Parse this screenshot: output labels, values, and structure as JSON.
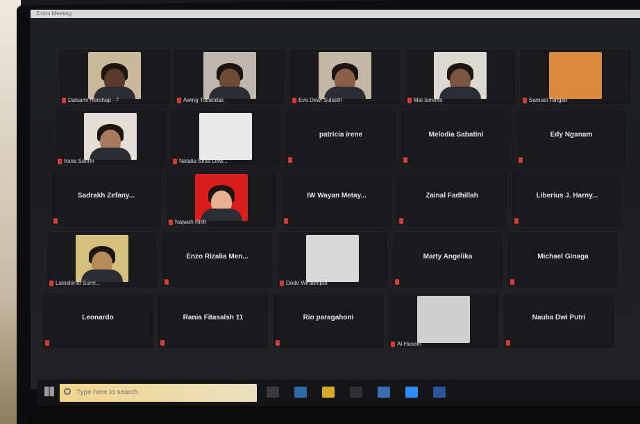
{
  "window": {
    "title": "Zoom Meeting"
  },
  "participants": [
    {
      "name": "Dalsami Harahap - 7",
      "mode": "video",
      "muted": true,
      "bg": "#c9b99a",
      "skin": "#5a3a2a"
    },
    {
      "name": "Awing Tobandas",
      "mode": "video",
      "muted": true,
      "bg": "#bdb7ad",
      "skin": "#6b4a36"
    },
    {
      "name": "Eva Dewi Sulastri",
      "mode": "video",
      "muted": true,
      "bg": "#c3b8a6",
      "skin": "#8a6048"
    },
    {
      "name": "Mai Ismeira",
      "mode": "video",
      "muted": true,
      "bg": "#dcd8d2",
      "skin": "#7a5640"
    },
    {
      "name": "Samuel Tarigan",
      "mode": "image",
      "muted": true,
      "bg": "#d98a3a"
    },
    {
      "name": "Irana Sahrin",
      "mode": "video",
      "muted": true,
      "bg": "#e2ddd6",
      "skin": "#a77a5c"
    },
    {
      "name": "Natalia Sinta Dew...",
      "mode": "image",
      "muted": true,
      "bg": "#e9e9e9"
    },
    {
      "name": "patricia irene",
      "mode": "name",
      "muted": true
    },
    {
      "name": "Melodia Sabatini",
      "mode": "name",
      "muted": true
    },
    {
      "name": "Edy Nganam",
      "mode": "name",
      "muted": true
    },
    {
      "name": "Sadrakh Zefany...",
      "mode": "name",
      "muted": true
    },
    {
      "name": "Najwah Ririh",
      "mode": "video",
      "muted": true,
      "bg": "#d91c1c",
      "skin": "#e7b08f"
    },
    {
      "name": "IW Wayan Metay...",
      "mode": "name",
      "muted": true
    },
    {
      "name": "Zainal Fadhillah",
      "mode": "name",
      "muted": true
    },
    {
      "name": "Liberius J. Harny...",
      "mode": "name",
      "muted": true
    },
    {
      "name": "Latoshinto Surei...",
      "mode": "video",
      "muted": true,
      "bg": "#d6c07e",
      "skin": "#b78c5b"
    },
    {
      "name": "Enzo Rizalia Men...",
      "mode": "name",
      "muted": true
    },
    {
      "name": "Dodo Wiradhipta",
      "mode": "image",
      "muted": true,
      "bg": "#d8d8d8"
    },
    {
      "name": "Marty Angelika",
      "mode": "name",
      "muted": true
    },
    {
      "name": "Michael Ginaga",
      "mode": "name",
      "muted": true
    },
    {
      "name": "Leonardo",
      "mode": "name",
      "muted": true
    },
    {
      "name": "Rania Fitasalsh 11",
      "mode": "name",
      "muted": true
    },
    {
      "name": "Rio paragahoni",
      "mode": "name",
      "muted": true
    },
    {
      "name": "Al-Husein",
      "mode": "image",
      "muted": true,
      "bg": "#cfcfcf"
    },
    {
      "name": "Nauba Dwi Putri",
      "mode": "name",
      "muted": true
    }
  ],
  "taskbar": {
    "search_placeholder": "Type here to search",
    "icons": [
      {
        "name": "task-view-icon",
        "color": "#3a3a3e"
      },
      {
        "name": "edge-icon",
        "color": "#2b6aa6"
      },
      {
        "name": "file-explorer-icon",
        "color": "#d7a928"
      },
      {
        "name": "store-icon",
        "color": "#2e2e33"
      },
      {
        "name": "mail-icon",
        "color": "#3a6cb0"
      },
      {
        "name": "zoom-icon",
        "color": "#2d8cff"
      },
      {
        "name": "word-icon",
        "color": "#2b579a"
      }
    ]
  },
  "colors": {
    "muted_mic": "#d23a3a",
    "tile_bg": "#1a1a1d"
  }
}
